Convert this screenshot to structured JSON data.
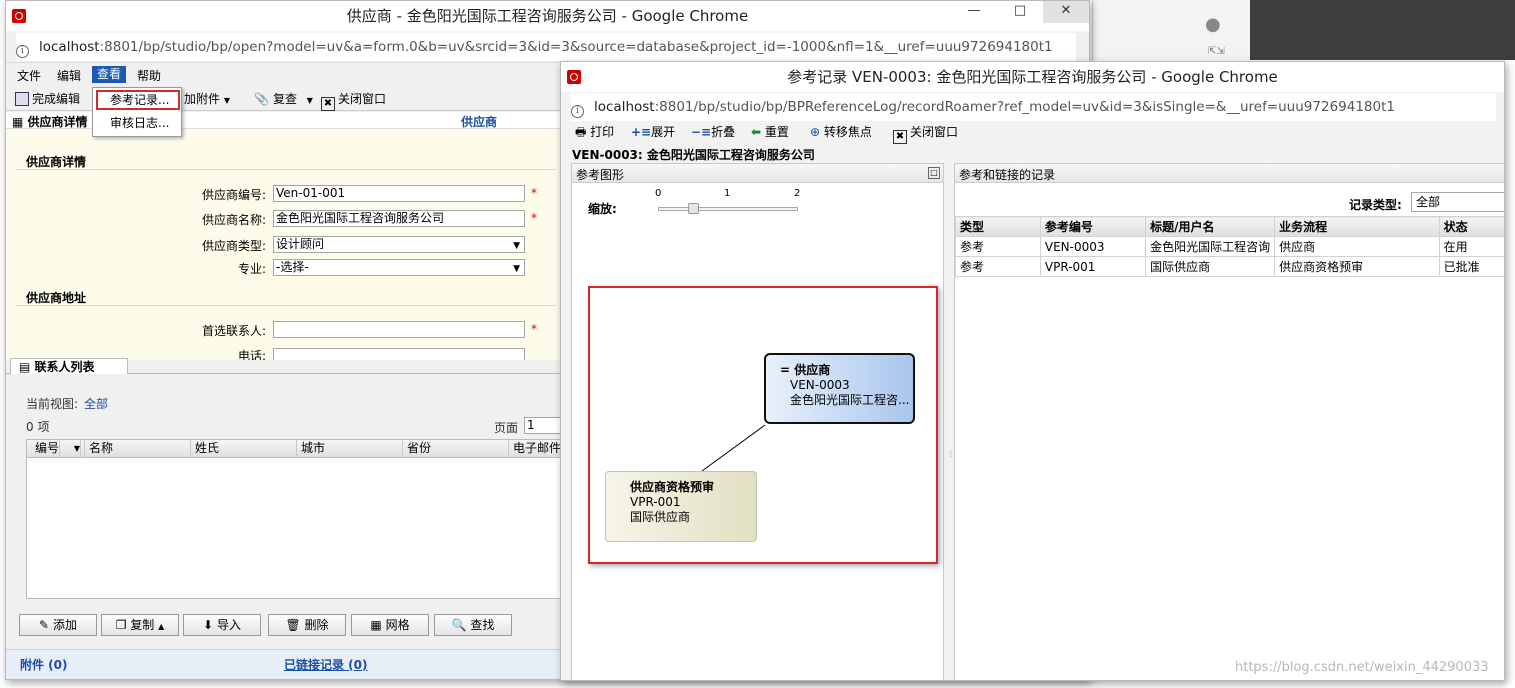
{
  "main_window": {
    "title": "供应商 - 金色阳光国际工程咨询服务公司 - Google Chrome",
    "url_host": "localhost",
    "url_rest": ":8801/bp/studio/bp/open?model=uv&a=form.0&b=uv&srcid=3&id=3&source=database&project_id=-1000&nfl=1&__uref=uuu972694180t1",
    "menu": [
      "文件",
      "编辑",
      "查看",
      "帮助"
    ],
    "toolbar": {
      "finish_edit": "完成编辑",
      "add_attachment": "加附件",
      "review": "复查",
      "close_window": "关闭窗口"
    },
    "dropdown": {
      "ref_log": "参考记录...",
      "audit_log": "审核日志..."
    },
    "tabs": {
      "vendor_detail_tab": "供应商详情",
      "vendor_header": "供应商"
    },
    "section_detail": "供应商详情",
    "fields": {
      "vendor_no_label": "供应商编号:",
      "vendor_no_value": "Ven-01-001",
      "vendor_name_label": "供应商名称:",
      "vendor_name_value": "金色阳光国际工程咨询服务公司",
      "vendor_type_label": "供应商类型:",
      "vendor_type_value": "设计顾问",
      "specialty_label": "专业:",
      "specialty_value": "-选择-",
      "required": "*"
    },
    "section_address": "供应商地址",
    "address_fields": {
      "contact_label": "首选联系人:",
      "phone_label": "电话:"
    },
    "contacts": {
      "tab": "联系人列表",
      "view_label": "当前视图:",
      "view_value": "全部",
      "count": "0 项",
      "page_label": "页面",
      "page_value": "1",
      "columns": [
        "编号",
        "名称",
        "姓氏",
        "城市",
        "省份",
        "电子邮件"
      ]
    },
    "bottom_buttons": [
      "添加",
      "复制",
      "导入",
      "删除",
      "网格",
      "查找"
    ],
    "footer": {
      "attachments": "附件 (0)",
      "linked": "已链接记录 (0)"
    }
  },
  "ref_window": {
    "title": "参考记录 VEN-0003: 金色阳光国际工程咨询服务公司 - Google Chrome",
    "url_host": "localhost",
    "url_rest": ":8801/bp/studio/bp/BPReferenceLog/recordRoamer?ref_model=uv&id=3&isSingle=&__uref=uuu972694180t1",
    "toolbar": [
      "打印",
      "展开",
      "折叠",
      "重置",
      "转移焦点",
      "关闭窗口"
    ],
    "record_heading": "VEN-0003: 金色阳光国际工程咨询服务公司",
    "graph_panel_title": "参考图形",
    "zoom_label": "缩放:",
    "zoom_ticks": [
      "0",
      "1",
      "2"
    ],
    "zoom_value": 0.5,
    "node_main": {
      "title": "= 供应商",
      "line1": "VEN-0003",
      "line2": "金色阳光国际工程咨..."
    },
    "node_child": {
      "title": "供应商资格预审",
      "line1": "VPR-001",
      "line2": "国际供应商"
    },
    "records_panel_title": "参考和链接的记录",
    "record_type_label": "记录类型:",
    "record_type_value": "全部",
    "columns": [
      "类型",
      "参考编号",
      "标题/用户名",
      "业务流程",
      "状态"
    ],
    "rows": [
      [
        "参考",
        "VEN-0003",
        "金色阳光国际工程咨询",
        "供应商",
        "在用"
      ],
      [
        "参考",
        "VPR-001",
        "国际供应商",
        "供应商资格预审",
        "已批准"
      ]
    ]
  },
  "watermark": "https://blog.csdn.net/weixin_44290033",
  "colors": {
    "accent_blue": "#1a4fa3",
    "highlight_red": "#d42a2a",
    "form_bg": "#fdfbea",
    "node_main_bg": "#a9c6ee",
    "node_child_bg": "#e2e0c3"
  }
}
